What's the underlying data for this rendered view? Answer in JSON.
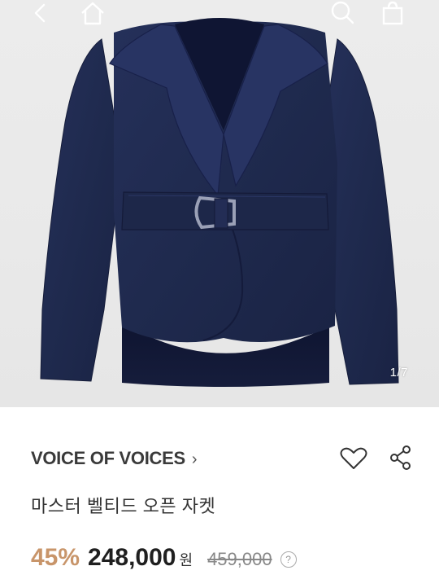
{
  "topbar": {
    "icons": [
      "back-icon",
      "home-icon",
      "search-icon",
      "cart-icon"
    ]
  },
  "gallery": {
    "counter": "1/7"
  },
  "product": {
    "brand": "VOICE OF VOICES",
    "brand_chevron": "›",
    "title": "마스터 벨티드 오픈 자켓",
    "discount": "45%",
    "price": "248,000",
    "currency": "원",
    "original_price": "459,000",
    "info_mark": "?"
  },
  "colors": {
    "jacket_navy": "#1f2a4e",
    "discount": "#c8956a"
  }
}
